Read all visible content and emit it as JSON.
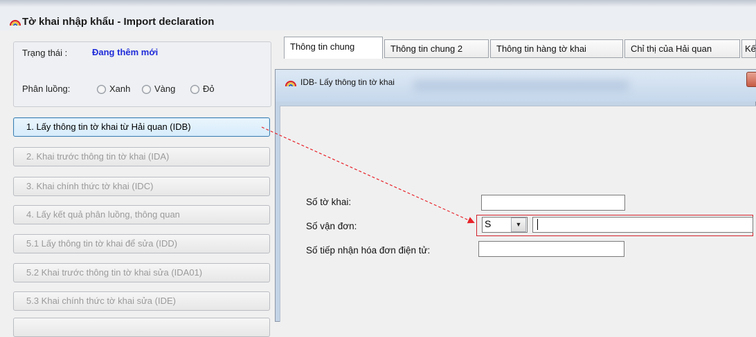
{
  "window": {
    "title": "Tờ khai nhập khẩu - Import declaration",
    "logo_icon": "rainbow-arc-icon"
  },
  "status": {
    "label": "Trạng thái :",
    "value": "Đang thêm mới",
    "value_color": "#1f2bd8"
  },
  "channel": {
    "label": "Phân luồng:",
    "options": [
      {
        "label": "Xanh"
      },
      {
        "label": "Vàng"
      },
      {
        "label": "Đỏ"
      }
    ]
  },
  "actions": [
    {
      "label": "1. Lấy thông tin tờ khai từ Hải quan (IDB)",
      "enabled": true
    },
    {
      "label": "2. Khai trước thông tin tờ khai (IDA)",
      "enabled": false
    },
    {
      "label": "3. Khai chính thức tờ khai (IDC)",
      "enabled": false
    },
    {
      "label": "4. Lấy kết quả phân luồng, thông quan",
      "enabled": false
    },
    {
      "label": "5.1 Lấy thông tin tờ khai để sửa (IDD)",
      "enabled": false
    },
    {
      "label": "5.2 Khai trước thông tin tờ khai sửa (IDA01)",
      "enabled": false
    },
    {
      "label": "5.3 Khai chính thức tờ khai sửa (IDE)",
      "enabled": false
    },
    {
      "label": "",
      "enabled": false
    }
  ],
  "tabs": [
    {
      "label": "Thông tin chung",
      "selected": true
    },
    {
      "label": "Thông tin chung 2",
      "selected": false
    },
    {
      "label": "Thông tin hàng tờ khai",
      "selected": false
    },
    {
      "label": "Chỉ thị của Hải quan",
      "selected": false
    },
    {
      "label": "Kế",
      "selected": false
    }
  ],
  "dialog": {
    "title": "IDB- Lấy thông tin tờ khai",
    "fields": {
      "declaration_no": {
        "label": "Số tờ khai:",
        "value": ""
      },
      "bill_of_lading": {
        "label": "Số vận đơn:",
        "type_value": "S",
        "value": ""
      },
      "e_invoice_no": {
        "label": "Số tiếp nhận hóa đơn điện tử:",
        "value": ""
      }
    }
  },
  "annotation": {
    "arrow_color": "#e8232a",
    "highlight_color": "#d1202a"
  }
}
